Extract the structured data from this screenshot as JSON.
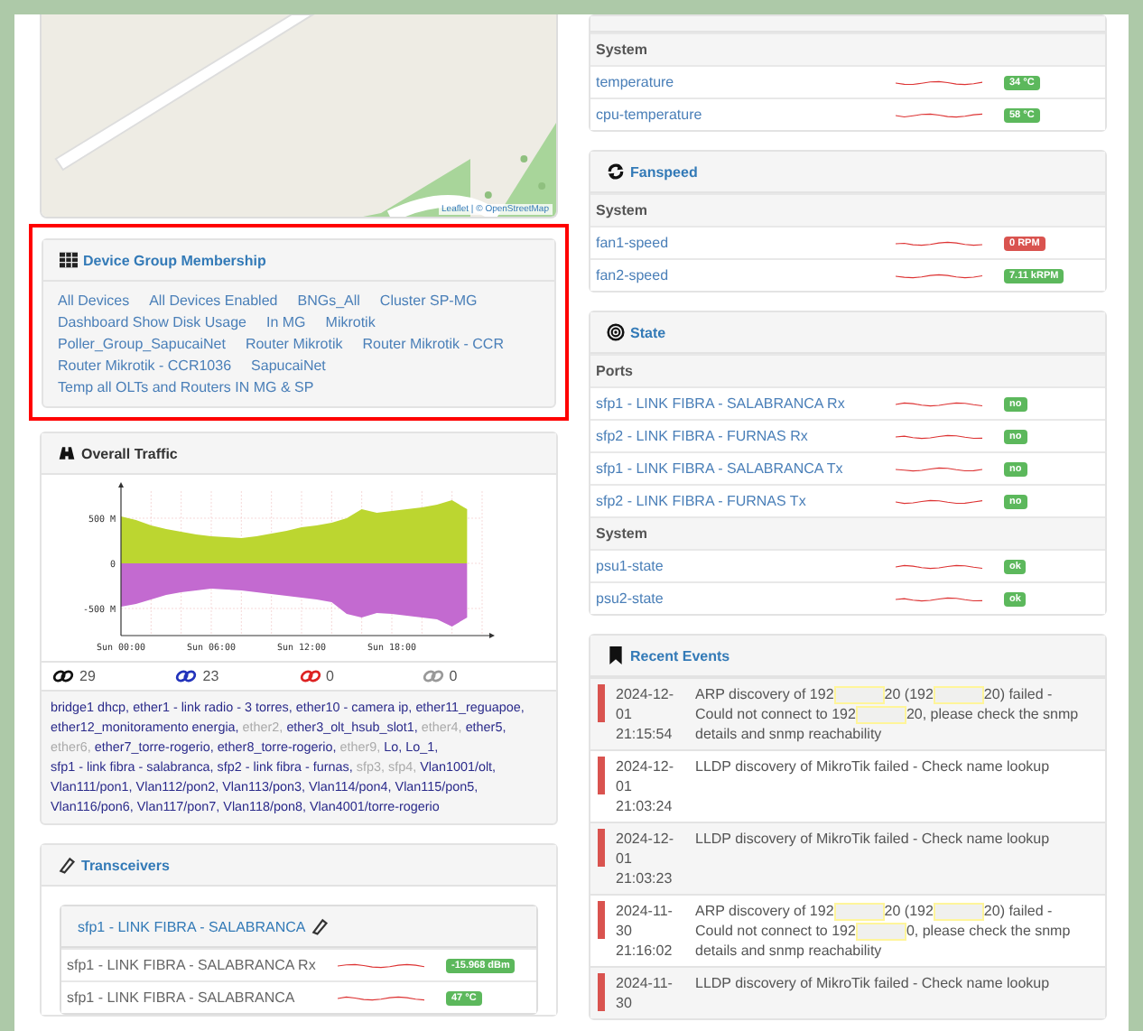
{
  "map": {
    "attribution": "Leaflet | © OpenStreetMap"
  },
  "groups": {
    "title": "Device Group Membership",
    "highlighted": true,
    "items": [
      "All Devices",
      "All Devices Enabled",
      "BNGs_All",
      "Cluster SP-MG",
      "Dashboard Show Disk Usage",
      "In MG",
      "Mikrotik",
      "Poller_Group_SapucaiNet",
      "Router Mikrotik",
      "Router Mikrotik - CCR",
      "Router Mikrotik - CCR1036",
      "SapucaiNet",
      "Temp all OLTs and Routers IN MG & SP"
    ]
  },
  "traffic": {
    "title": "Overall Traffic",
    "chart_data": {
      "type": "area",
      "categories": [
        "Sun 00:00",
        null,
        null,
        null,
        null,
        null,
        "Sun 06:00",
        null,
        null,
        null,
        null,
        null,
        "Sun 12:00",
        null,
        null,
        null,
        null,
        null,
        "Sun 18:00",
        null,
        null,
        null,
        null,
        null
      ],
      "yticks": [
        {
          "value": 500,
          "label": "500 M"
        },
        {
          "value": 0,
          "label": "0"
        },
        {
          "value": -500,
          "label": "-500 M"
        }
      ],
      "ylim": [
        -800,
        800
      ],
      "grid": true,
      "series": [
        {
          "color": "#bcd630",
          "values": [
            520,
            480,
            420,
            380,
            350,
            320,
            300,
            290,
            280,
            300,
            330,
            360,
            400,
            420,
            450,
            500,
            600,
            560,
            580,
            600,
            620,
            650,
            700,
            600
          ]
        },
        {
          "color": "#c36ad0",
          "values": [
            -480,
            -450,
            -400,
            -350,
            -320,
            -300,
            -280,
            -290,
            -300,
            -320,
            -340,
            -360,
            -380,
            -400,
            -430,
            -560,
            -600,
            -550,
            -560,
            -580,
            -600,
            -620,
            -700,
            -600
          ]
        }
      ]
    },
    "counts": [
      {
        "value": "29",
        "color": "#111111"
      },
      {
        "value": "23",
        "color": "#2233bb"
      },
      {
        "value": "0",
        "color": "#dd2222"
      },
      {
        "value": "0",
        "color": "#999999"
      }
    ],
    "ports": [
      {
        "name": "bridge1 dhcp,",
        "disabled": false
      },
      {
        "name": "ether1 - link radio - 3 torres,",
        "disabled": false
      },
      {
        "name": "ether10 - camera ip,",
        "disabled": false
      },
      {
        "name": "ether11_reguapoe,",
        "disabled": false
      },
      {
        "name": "ether12_monitoramento energia,",
        "disabled": false
      },
      {
        "name": "ether2,",
        "disabled": true
      },
      {
        "name": "ether3_olt_hsub_slot1,",
        "disabled": false
      },
      {
        "name": "ether4,",
        "disabled": true
      },
      {
        "name": "ether5,",
        "disabled": false
      },
      {
        "name": "ether6,",
        "disabled": true
      },
      {
        "name": "ether7_torre-rogerio,",
        "disabled": false
      },
      {
        "name": "ether8_torre-rogerio,",
        "disabled": false
      },
      {
        "name": "ether9,",
        "disabled": true
      },
      {
        "name": "Lo,",
        "disabled": false
      },
      {
        "name": "Lo_1,",
        "disabled": false
      },
      {
        "name": "sfp1 - link fibra - salabranca,",
        "disabled": false
      },
      {
        "name": "sfp2 - link fibra - furnas,",
        "disabled": false
      },
      {
        "name": "sfp3,",
        "disabled": true
      },
      {
        "name": "sfp4,",
        "disabled": true
      },
      {
        "name": "Vlan1001/olt,",
        "disabled": false
      },
      {
        "name": "Vlan111/pon1,",
        "disabled": false
      },
      {
        "name": "Vlan112/pon2,",
        "disabled": false
      },
      {
        "name": "Vlan113/pon3,",
        "disabled": false
      },
      {
        "name": "Vlan114/pon4,",
        "disabled": false
      },
      {
        "name": "Vlan115/pon5,",
        "disabled": false
      },
      {
        "name": "Vlan116/pon6,",
        "disabled": false
      },
      {
        "name": "Vlan117/pon7,",
        "disabled": false
      },
      {
        "name": "Vlan118/pon8,",
        "disabled": false
      },
      {
        "name": "Vlan4001/torre-rogerio",
        "disabled": false
      }
    ]
  },
  "transceivers": {
    "title": "Transceivers",
    "port": "sfp1 - LINK FIBRA - SALABRANCA",
    "rows": [
      {
        "name": "sfp1 - LINK FIBRA - SALABRANCA Rx",
        "value": "-15.968 dBm",
        "color": "#5cb85c"
      },
      {
        "name": "sfp1 - LINK FIBRA - SALABRANCA",
        "value": "47 °C",
        "color": "#5cb85c"
      }
    ]
  },
  "sensor_panels": [
    {
      "sections": [
        {
          "label": "System",
          "rows": [
            {
              "name": "temperature",
              "value": "34 °C",
              "color": "#5cb85c"
            },
            {
              "name": "cpu-temperature",
              "value": "58 °C",
              "color": "#5cb85c"
            }
          ]
        }
      ]
    },
    {
      "kind": "fanspeed",
      "title": "Fanspeed",
      "sections": [
        {
          "label": "System",
          "rows": [
            {
              "name": "fan1-speed",
              "value": "0 RPM",
              "color": "#d9534f"
            },
            {
              "name": "fan2-speed",
              "value": "7.11 kRPM",
              "color": "#5cb85c"
            }
          ]
        }
      ]
    },
    {
      "kind": "state",
      "title": "State",
      "sections": [
        {
          "label": "Ports",
          "rows": [
            {
              "name": "sfp1 - LINK FIBRA - SALABRANCA Rx",
              "value": "no",
              "color": "#5cb85c"
            },
            {
              "name": "sfp2 - LINK FIBRA - FURNAS Rx",
              "value": "no",
              "color": "#5cb85c"
            },
            {
              "name": "sfp1 - LINK FIBRA - SALABRANCA Tx",
              "value": "no",
              "color": "#5cb85c"
            },
            {
              "name": "sfp2 - LINK FIBRA - FURNAS Tx",
              "value": "no",
              "color": "#5cb85c"
            }
          ]
        },
        {
          "label": "System",
          "rows": [
            {
              "name": "psu1-state",
              "value": "ok",
              "color": "#5cb85c"
            },
            {
              "name": "psu2-state",
              "value": "ok",
              "color": "#5cb85c"
            }
          ]
        }
      ]
    }
  ],
  "events": {
    "title": "Recent Events",
    "items": [
      {
        "date": "2024-12-01",
        "time": "21:15:54",
        "segments": [
          {
            "kind": "text",
            "text": "ARP discovery of 192"
          },
          {
            "kind": "redacted"
          },
          {
            "kind": "text",
            "text": "20 (192"
          },
          {
            "kind": "redacted"
          },
          {
            "kind": "text",
            "text": "20) failed -"
          },
          {
            "kind": "text",
            "text": "Could not connect to 192"
          },
          {
            "kind": "redacted"
          },
          {
            "kind": "text",
            "text": "20, please check the snmp"
          },
          {
            "kind": "text",
            "text": "details and snmp reachability"
          }
        ]
      },
      {
        "date": "2024-12-01",
        "time": "21:03:24",
        "segments": [
          {
            "kind": "text",
            "text": "LLDP discovery of MikroTik failed - Check name lookup"
          }
        ]
      },
      {
        "date": "2024-12-01",
        "time": "21:03:23",
        "segments": [
          {
            "kind": "text",
            "text": "LLDP discovery of MikroTik failed - Check name lookup"
          }
        ]
      },
      {
        "date": "2024-11-30",
        "time": "21:16:02",
        "segments": [
          {
            "kind": "text",
            "text": "ARP discovery of 192"
          },
          {
            "kind": "redacted"
          },
          {
            "kind": "text",
            "text": "20 (192"
          },
          {
            "kind": "redacted"
          },
          {
            "kind": "text",
            "text": "20) failed -"
          },
          {
            "kind": "text",
            "text": "Could not connect to 192"
          },
          {
            "kind": "redacted"
          },
          {
            "kind": "text",
            "text": "0, please check the snmp"
          },
          {
            "kind": "text",
            "text": "details and snmp reachability"
          }
        ]
      },
      {
        "date": "2024-11-30",
        "segments": [
          {
            "kind": "text",
            "text": "LLDP discovery of MikroTik failed - Check name lookup"
          }
        ]
      }
    ]
  }
}
